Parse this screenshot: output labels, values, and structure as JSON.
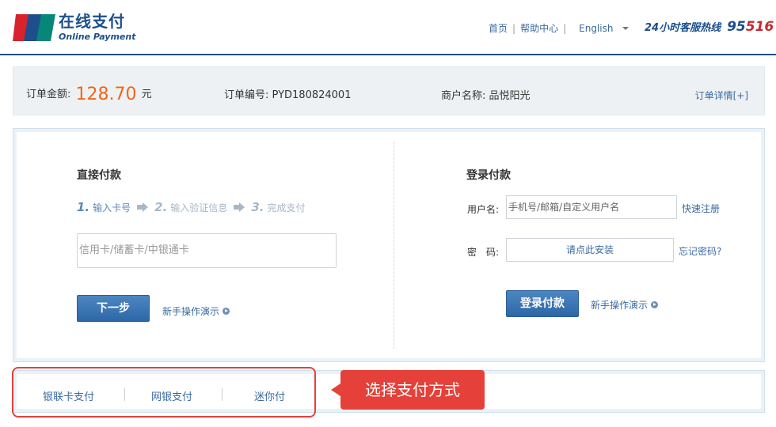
{
  "header": {
    "logo_text_top": "UnionPay",
    "logo_text_bottom": "银联",
    "title_cn": "在线支付",
    "title_en": "Online Payment",
    "nav": {
      "home": "首页",
      "help": "帮助中心",
      "language": "English"
    },
    "hotline_label": "24小时客服热线",
    "hotline_prefix": "95",
    "hotline_suffix": "516"
  },
  "order": {
    "amount_label": "订单金额:",
    "amount_value": "128.70",
    "amount_unit": "元",
    "number_label": "订单编号:",
    "number_value": "PYD180824001",
    "merchant_label": "商户名称:",
    "merchant_value": "品悦阳光",
    "detail_link": "订单详情[+]"
  },
  "direct_pay": {
    "title": "直接付款",
    "steps": [
      {
        "num": "1.",
        "label": "输入卡号"
      },
      {
        "num": "2.",
        "label": "输入验证信息"
      },
      {
        "num": "3.",
        "label": "完成支付"
      }
    ],
    "card_placeholder": "信用卡/储蓄卡/中银通卡",
    "next_button": "下一步",
    "demo_link": "新手操作演示"
  },
  "login_pay": {
    "title": "登录付款",
    "username_label": "用户名:",
    "username_placeholder": "手机号/邮箱/自定义用户名",
    "register_link": "快速注册",
    "password_label": "密　码:",
    "password_install": "请点此安装",
    "forgot_link": "忘记密码?",
    "login_button": "登录付款",
    "demo_link": "新手操作演示"
  },
  "methods": {
    "tabs": [
      "银联卡支付",
      "网银支付",
      "迷你付"
    ]
  },
  "callout": {
    "text": "选择支付方式"
  },
  "colors": {
    "brand_blue": "#1c4f8c",
    "amount_orange": "#f0661a",
    "callout_red": "#e5413a"
  }
}
